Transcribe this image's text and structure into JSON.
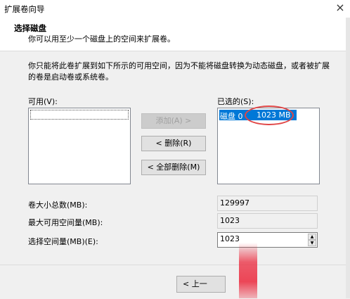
{
  "window": {
    "title": "扩展卷向导",
    "close_glyph": "×"
  },
  "header": {
    "title": "选择磁盘",
    "subtitle": "你可以用至少一个磁盘上的空间来扩展卷。"
  },
  "intro": "你只能将此卷扩展到如下所示的可用空间，因为不能将磁盘转换为动态磁盘，或者被扩展的卷是启动卷或系统卷。",
  "available": {
    "label": "可用(V):",
    "items": []
  },
  "selected": {
    "label": "已选的(S):",
    "items": [
      {
        "disk": "磁盘 0",
        "size": "1023 MB"
      }
    ]
  },
  "buttons": {
    "add": "添加(A) >",
    "remove": "< 删除(R)",
    "remove_all": "< 全部删除(M)",
    "back": "< 上一"
  },
  "fields": {
    "total_size_label": "卷大小总数(MB):",
    "total_size_value": "129997",
    "max_space_label": "最大可用空间量(MB):",
    "max_space_value": "1023",
    "select_space_label": "选择空间量(MB)(E):",
    "select_space_value": "1023"
  },
  "colors": {
    "selection": "#0078d7",
    "annotation": "#e04646"
  }
}
